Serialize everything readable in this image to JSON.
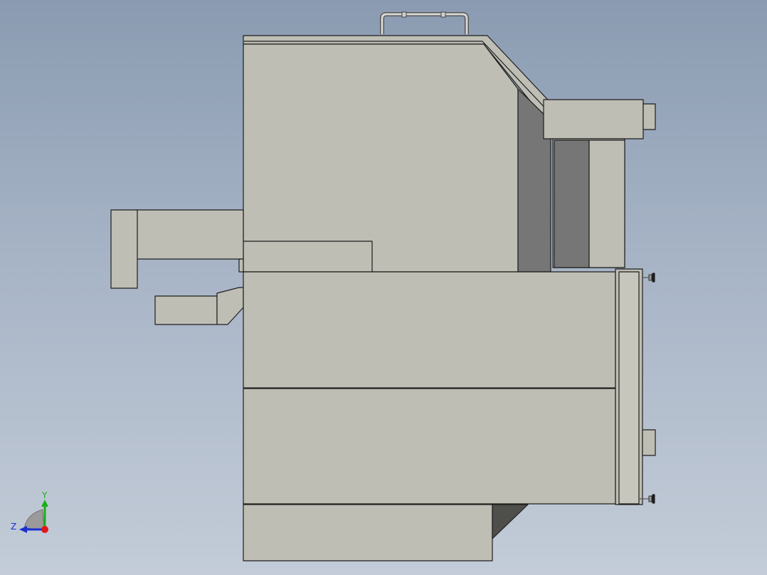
{
  "viewport": {
    "background_top": "#8a9bb1",
    "background_bottom": "#c3ccd8",
    "model_face_color": "#bebeb5",
    "model_edge_color": "#1e1e1e",
    "model_shadow_color": "#767676"
  },
  "triad": {
    "y_label": "Y",
    "z_label": "Z",
    "y_axis_color": "#18b018",
    "z_axis_color": "#1a2fd0",
    "x_axis_color": "#e01818"
  }
}
